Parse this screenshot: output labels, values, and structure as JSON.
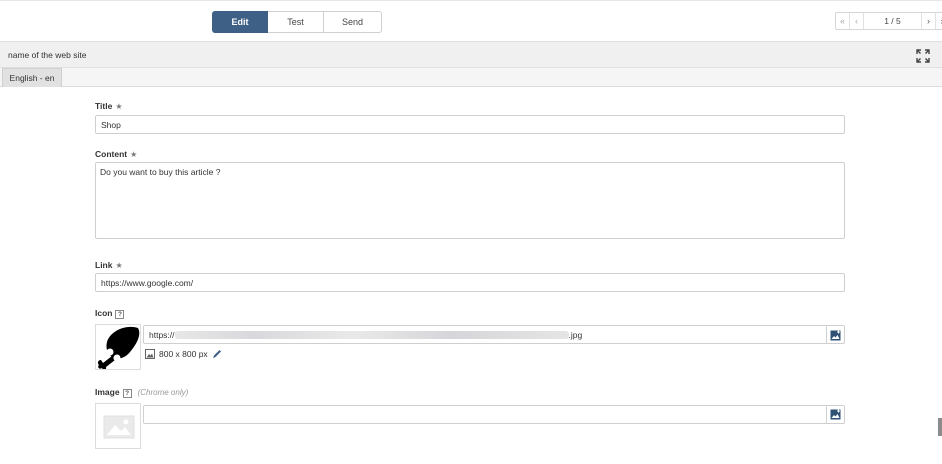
{
  "toolbar": {
    "tabs": [
      {
        "label": "Edit",
        "active": true
      },
      {
        "label": "Test",
        "active": false
      },
      {
        "label": "Send",
        "active": false
      }
    ]
  },
  "pager": {
    "first": "«",
    "prev": "‹",
    "info": "1 / 5",
    "next": "›",
    "last": "»"
  },
  "site": {
    "name": "name of the web site",
    "expand_icon": "expand-arrows-icon"
  },
  "language_tab": "English - en",
  "form": {
    "title": {
      "label": "Title",
      "required_mark": "★",
      "value": "Shop"
    },
    "content": {
      "label": "Content",
      "required_mark": "★",
      "value": "Do you want to buy this article ?"
    },
    "link": {
      "label": "Link",
      "required_mark": "★",
      "value": "https://www.google.com/"
    },
    "icon": {
      "label": "Icon",
      "help": "?",
      "url_prefix": "https://",
      "url_suffix": ".jpg",
      "dimensions": "800 x 800 px",
      "picker_icon": "image-picker-icon",
      "edit_icon": "pencil-icon"
    },
    "image": {
      "label": "Image",
      "help": "?",
      "hint": "(Chrome only)",
      "value": "",
      "picker_icon": "image-picker-icon",
      "placeholder_icon": "image-placeholder-icon"
    }
  },
  "colors": {
    "accent": "#3e5f86",
    "header_bg": "#f0f0f0"
  }
}
